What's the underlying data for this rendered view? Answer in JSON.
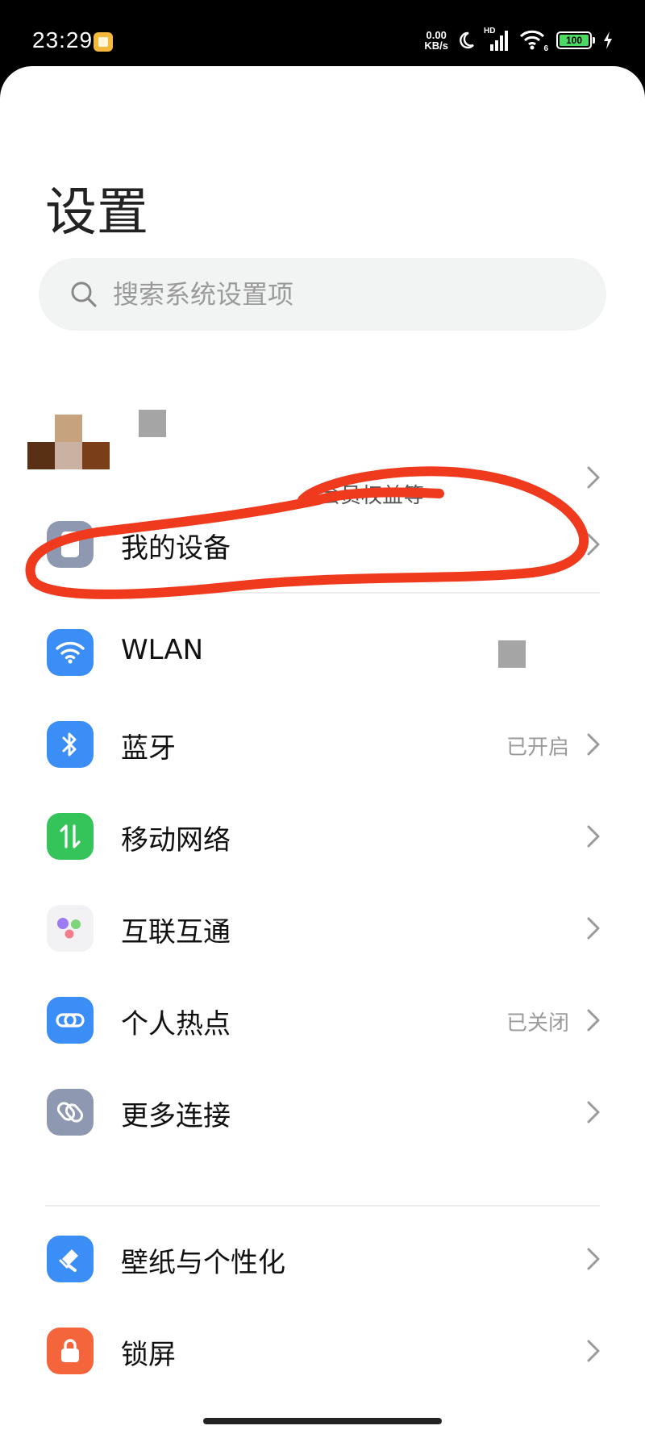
{
  "status_bar": {
    "time": "23:29",
    "speed_value": "0.00",
    "speed_unit": "KB/s",
    "signal_label": "HD",
    "wifi_label": "6",
    "battery": "100"
  },
  "page_title": "设置",
  "search": {
    "placeholder": "搜索系统设置项"
  },
  "account": {
    "subtitle": "、会员权益等"
  },
  "my_device": {
    "label": "我的设备"
  },
  "groups": {
    "connectivity": [
      {
        "key": "wlan",
        "label": "WLAN",
        "value": "",
        "icon": "wifi-icon",
        "color": "#3a8ef6"
      },
      {
        "key": "bluetooth",
        "label": "蓝牙",
        "value": "已开启",
        "icon": "bluetooth-icon",
        "color": "#3a8ef6"
      },
      {
        "key": "mobile",
        "label": "移动网络",
        "value": "",
        "icon": "mobile-network-icon",
        "color": "#35c45a"
      },
      {
        "key": "interconnect",
        "label": "互联互通",
        "value": "",
        "icon": "interconnect-icon",
        "color": "#f2f2f4"
      },
      {
        "key": "hotspot",
        "label": "个人热点",
        "value": "已关闭",
        "icon": "hotspot-icon",
        "color": "#3a8ef6"
      },
      {
        "key": "more",
        "label": "更多连接",
        "value": "",
        "icon": "more-connections-icon",
        "color": "#8e98b0"
      }
    ],
    "personal": [
      {
        "key": "wallpaper",
        "label": "壁纸与个性化",
        "value": "",
        "icon": "wallpaper-icon",
        "color": "#3a8ef6"
      },
      {
        "key": "lockscreen",
        "label": "锁屏",
        "value": "",
        "icon": "lock-icon",
        "color": "#f4653c"
      }
    ]
  },
  "colors": {
    "accent_blue": "#3a8ef6",
    "annotation_red": "#f03a1e"
  }
}
